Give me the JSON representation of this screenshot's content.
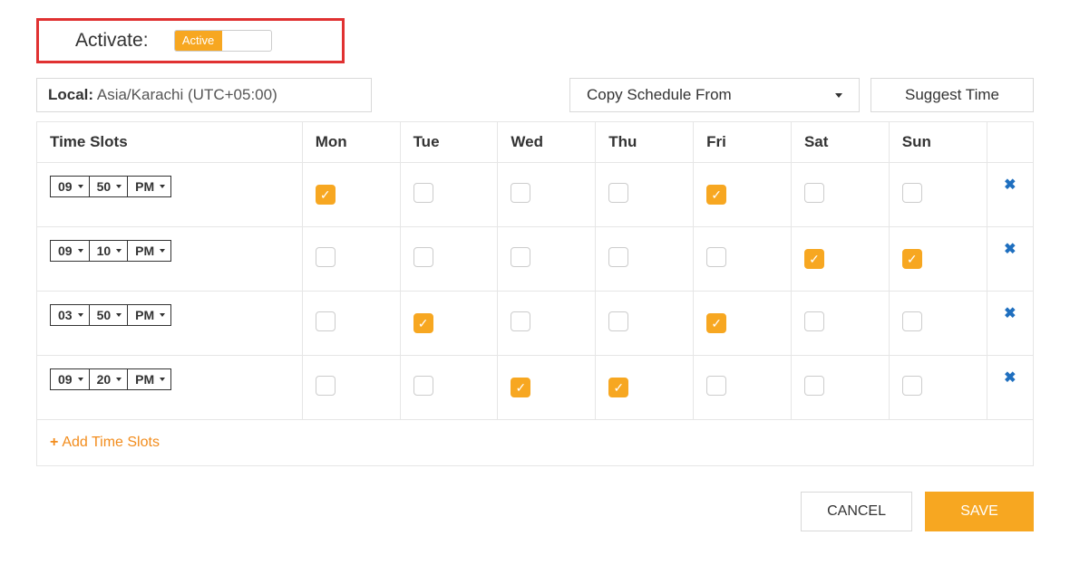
{
  "activate": {
    "label": "Activate:",
    "toggle": "Active"
  },
  "controls": {
    "local_label": "Local:",
    "local_value": "Asia/Karachi (UTC+05:00)",
    "copy": "Copy Schedule From",
    "suggest": "Suggest Time"
  },
  "table": {
    "headers": {
      "slots": "Time Slots",
      "days": [
        "Mon",
        "Tue",
        "Wed",
        "Thu",
        "Fri",
        "Sat",
        "Sun"
      ]
    },
    "rows": [
      {
        "hh": "09",
        "mm": "50",
        "ap": "PM",
        "ticks": [
          true,
          false,
          false,
          false,
          true,
          false,
          false
        ]
      },
      {
        "hh": "09",
        "mm": "10",
        "ap": "PM",
        "ticks": [
          false,
          false,
          false,
          false,
          false,
          true,
          true
        ]
      },
      {
        "hh": "03",
        "mm": "50",
        "ap": "PM",
        "ticks": [
          false,
          true,
          false,
          false,
          true,
          false,
          false
        ]
      },
      {
        "hh": "09",
        "mm": "20",
        "ap": "PM",
        "ticks": [
          false,
          false,
          true,
          true,
          false,
          false,
          false
        ]
      }
    ],
    "add": "Add Time Slots"
  },
  "footer": {
    "cancel": "CANCEL",
    "save": "SAVE"
  }
}
